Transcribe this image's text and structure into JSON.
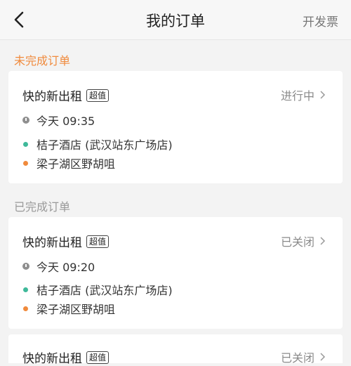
{
  "header": {
    "title": "我的订单",
    "action": "开发票"
  },
  "sections": {
    "pending": {
      "title": "未完成订单",
      "color": "#f08a3c"
    },
    "done": {
      "title": "已完成订单",
      "color": "#999999"
    }
  },
  "orders": [
    {
      "company": "快的新出租",
      "badge": "超值",
      "status": "进行中",
      "time": "今天 09:35",
      "from": "桔子酒店 (武汉站东广场店)",
      "to": "梁子湖区野胡咀"
    },
    {
      "company": "快的新出租",
      "badge": "超值",
      "status": "已关闭",
      "time": "今天 09:20",
      "from": "桔子酒店 (武汉站东广场店)",
      "to": "梁子湖区野胡咀"
    },
    {
      "company": "快的新出租",
      "badge": "超值",
      "status": "已关闭"
    }
  ],
  "colors": {
    "origin_dot": "#3fb99a",
    "destination_dot": "#f08a3c"
  }
}
